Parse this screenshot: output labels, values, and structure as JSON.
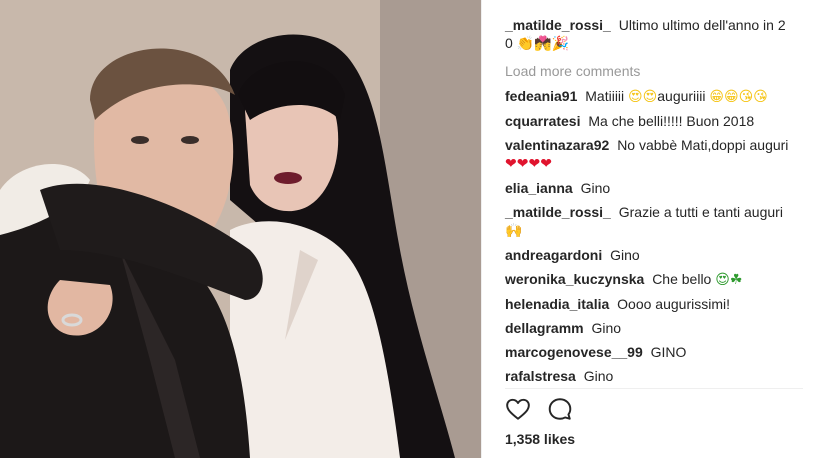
{
  "caption": {
    "user": "_matilde_rossi_",
    "text": "Ultimo ultimo dell'anno in 2",
    "text_line2": "0",
    "emojis": "👏💏🎉"
  },
  "load_more": "Load more comments",
  "comments": [
    {
      "user": "fedeania91",
      "text": "Matiiiii",
      "emoji_a": "😍😍",
      "text2": "auguriiii",
      "emoji_b": "😁😁😘😘"
    },
    {
      "user": "cquarratesi",
      "text": "Ma che belli!!!!! Buon 2018"
    },
    {
      "user": "valentinazara92",
      "text": "No vabbè Mati,doppi auguri",
      "emoji_a": "❤❤❤❤"
    },
    {
      "user": "elia_ianna",
      "text": "Gino"
    },
    {
      "user": "_matilde_rossi_",
      "text": "Grazie a tutti e tanti auguri",
      "emoji_a": "🙌"
    },
    {
      "user": "andreagardoni",
      "text": "Gino"
    },
    {
      "user": "weronika_kuczynska",
      "text": "Che bello",
      "emoji_a": "😍☘"
    },
    {
      "user": "helenadia_italia",
      "text": "Oooo augurissimi!"
    },
    {
      "user": "dellagramm",
      "text": "Gino"
    },
    {
      "user": "marcogenovese__99",
      "text": "GINO"
    },
    {
      "user": "rafalstresa",
      "text": "Gino"
    }
  ],
  "actions": {
    "like_icon": "heart-outline-icon",
    "comment_icon": "speech-bubble-icon"
  },
  "likes": "1,358 likes",
  "colors": {
    "text": "#262626",
    "muted": "#999999",
    "divider": "#efefef"
  }
}
